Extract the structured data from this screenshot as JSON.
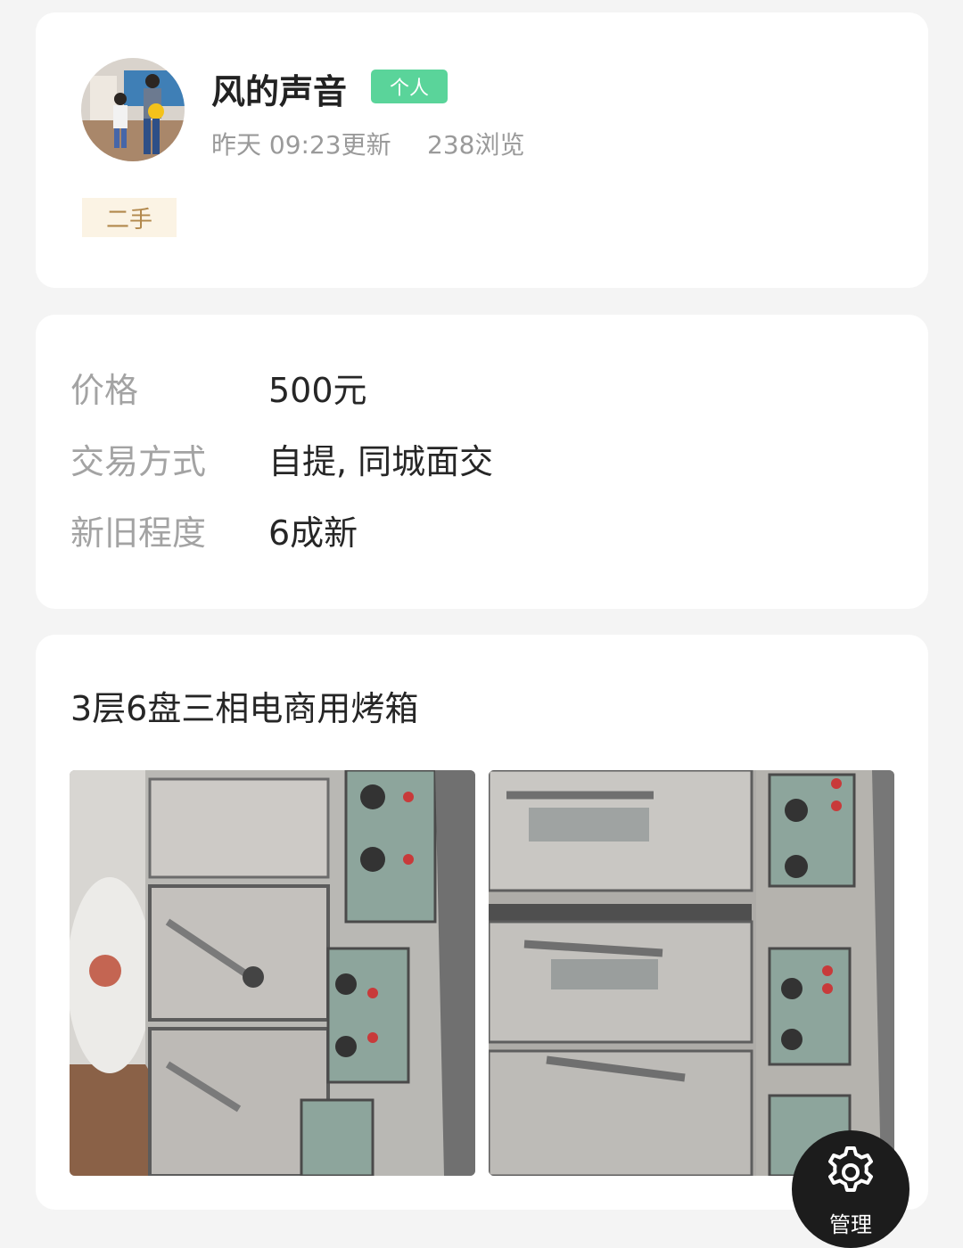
{
  "user": {
    "name": "风的声音",
    "badge": "个人",
    "updated": "昨天 09:23更新",
    "views": "238浏览",
    "tag": "二手"
  },
  "details": [
    {
      "label": "价格",
      "value": "500元"
    },
    {
      "label": "交易方式",
      "value": "自提, 同城面交"
    },
    {
      "label": "新旧程度",
      "value": "6成新"
    }
  ],
  "listing": {
    "title": "3层6盘三相电商用烤箱"
  },
  "fab": {
    "icon": "gear-icon",
    "label": "管理"
  },
  "colors": {
    "badge_green": "#5ad49a",
    "tag_bg": "#fbf3e4",
    "tag_text": "#b2884c",
    "fab_bg": "#1c1c1c"
  }
}
